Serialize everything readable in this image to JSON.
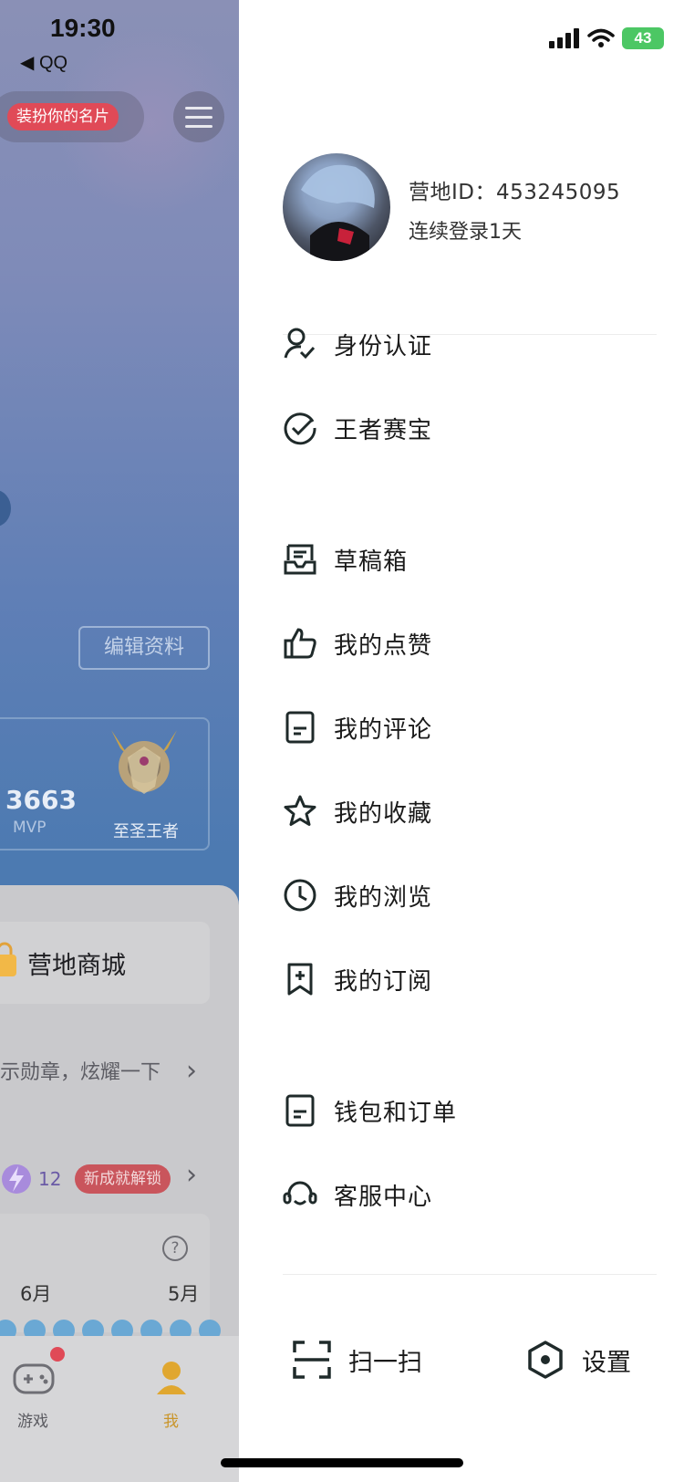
{
  "status_bar": {
    "time": "19:30",
    "back_app": "◀ QQ",
    "battery": "43"
  },
  "left_page": {
    "card_badge": "装扮你的名片",
    "edit_profile": "编辑资料",
    "stat_value": "3663",
    "stat_label": "MVP",
    "rank_label": "至圣王者",
    "shop_label": "营地商城",
    "medal_text": "示勋章，炫耀一下",
    "achievement_count": "12",
    "achievement_badge": "新成就解锁",
    "months": [
      "6月",
      "5月"
    ],
    "tabs": {
      "game": "游戏",
      "me": "我"
    }
  },
  "drawer": {
    "profile": {
      "id_label": "营地ID：453245095",
      "login_label": "连续登录1天"
    },
    "menu": [
      {
        "label": "身份认证",
        "icon": "identity-icon"
      },
      {
        "label": "王者赛宝",
        "icon": "check-circle-icon"
      },
      {
        "label": "草稿箱",
        "icon": "draft-box-icon"
      },
      {
        "label": "我的点赞",
        "icon": "thumbs-up-icon"
      },
      {
        "label": "我的评论",
        "icon": "comment-doc-icon"
      },
      {
        "label": "我的收藏",
        "icon": "star-icon"
      },
      {
        "label": "我的浏览",
        "icon": "clock-icon"
      },
      {
        "label": "我的订阅",
        "icon": "bookmark-plus-icon"
      },
      {
        "label": "钱包和订单",
        "icon": "wallet-doc-icon"
      },
      {
        "label": "客服中心",
        "icon": "headset-icon"
      }
    ],
    "bottom": {
      "scan": "扫一扫",
      "settings": "设置"
    }
  }
}
